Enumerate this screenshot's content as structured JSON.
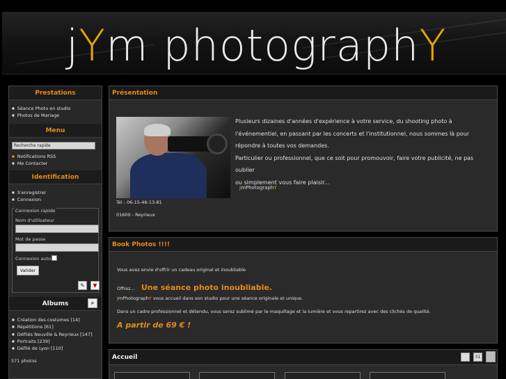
{
  "header": {
    "logo_part1": "j",
    "logo_y1": "Y",
    "logo_part2": "m photograph",
    "logo_y2": "Y"
  },
  "sidebar": {
    "prestations": {
      "title": "Prestations",
      "items": [
        "Séance Photo en studio",
        "Photos de Mariage"
      ]
    },
    "menu": {
      "title": "Menu",
      "search_value": "Recherche rapide",
      "items": [
        "Notifications RSS",
        "Me Contacter"
      ]
    },
    "identification": {
      "title": "Identification",
      "items": [
        "S'enregistrer",
        "Connexion"
      ],
      "quick_legend": "Connexion rapide",
      "username_label": "Nom d'utilisateur",
      "password_label": "Mot de passe",
      "autologin_label": "Connexion auto",
      "submit_label": "Valider"
    },
    "albums": {
      "title": "Albums",
      "items": [
        "Création des costumes [14]",
        "Répétitions [61]",
        "Défilés Neuville & Reyrieux [147]",
        "Portraits [239]",
        "Défilé de Lyon [110]"
      ],
      "count": "571 photos"
    }
  },
  "presentation": {
    "title": "Présentation",
    "line1": "Plusieurs dizaines d'années d'expérience à votre service, du shooting photo à",
    "line2": "l'événementiel,  en passant par les concerts et l'institutionnel, nous sommes là pour",
    "line3": "répondre à toutes vos demandes.",
    "line4": "Particulier ou professionnel, que ce soit pour promouvoir, faire votre publicité, ne pas oublier",
    "line5": "ou simplement vous faire plaisir...",
    "sig_j": "J",
    "sig_y1": "Y",
    "sig_mid": "mPhotograph",
    "sig_y2": "Y",
    "phone": "Tél : 06-15-46-13-81",
    "address": "01600 - Reyrieux"
  },
  "book": {
    "title": "Book Photos !!!!",
    "line1": "Vous avez envie d'offrir un cadeau original et inoubliable",
    "offer_prefix": "Offrez...",
    "offer_big": "Une séance photo inoubliable.",
    "line3_j": "J",
    "line3_y": "Y",
    "line3_mid": "mPhotograph",
    "line3_y2": "Y",
    "line3_rest": " vous accueil dans son studio pour une séance originale et unique.",
    "line4": "Dans un cadre professionnel et détendu, vous serez sublimé par le maquillage et la lumière et vous repartirez avec des clichés de qualité.",
    "price": "A partir de 69 € !"
  },
  "accueil": {
    "title": "Accueil",
    "calendar_number": "31"
  },
  "colors": {
    "accent_orange": "#e58a1c",
    "accent_yellow": "#e5a800",
    "panel_bg": "#2a2a2a"
  }
}
